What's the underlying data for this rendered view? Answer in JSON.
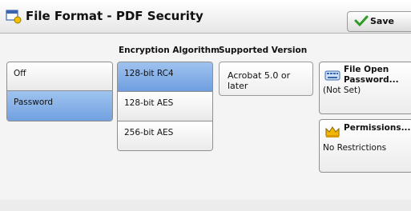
{
  "header": {
    "title": "File Format - PDF Security",
    "save_label": "Save"
  },
  "security": {
    "options": [
      {
        "label": "Off",
        "selected": false
      },
      {
        "label": "Password",
        "selected": true
      }
    ]
  },
  "encryption": {
    "header": "Encryption Algorithm",
    "options": [
      {
        "label": "128-bit RC4",
        "selected": true
      },
      {
        "label": "128-bit AES",
        "selected": false
      },
      {
        "label": "256-bit AES",
        "selected": false
      }
    ]
  },
  "supported_version": {
    "header": "Supported Version",
    "value": "Acrobat 5.0 or later"
  },
  "file_open_password": {
    "label_line1": "File Open",
    "label_line2": "Password...",
    "value": "(Not Set)"
  },
  "permissions": {
    "label": "Permissions...",
    "value": "No Restrictions"
  },
  "colors": {
    "selected_top": "#9fc3ef",
    "selected_bottom": "#6f9fe0"
  }
}
